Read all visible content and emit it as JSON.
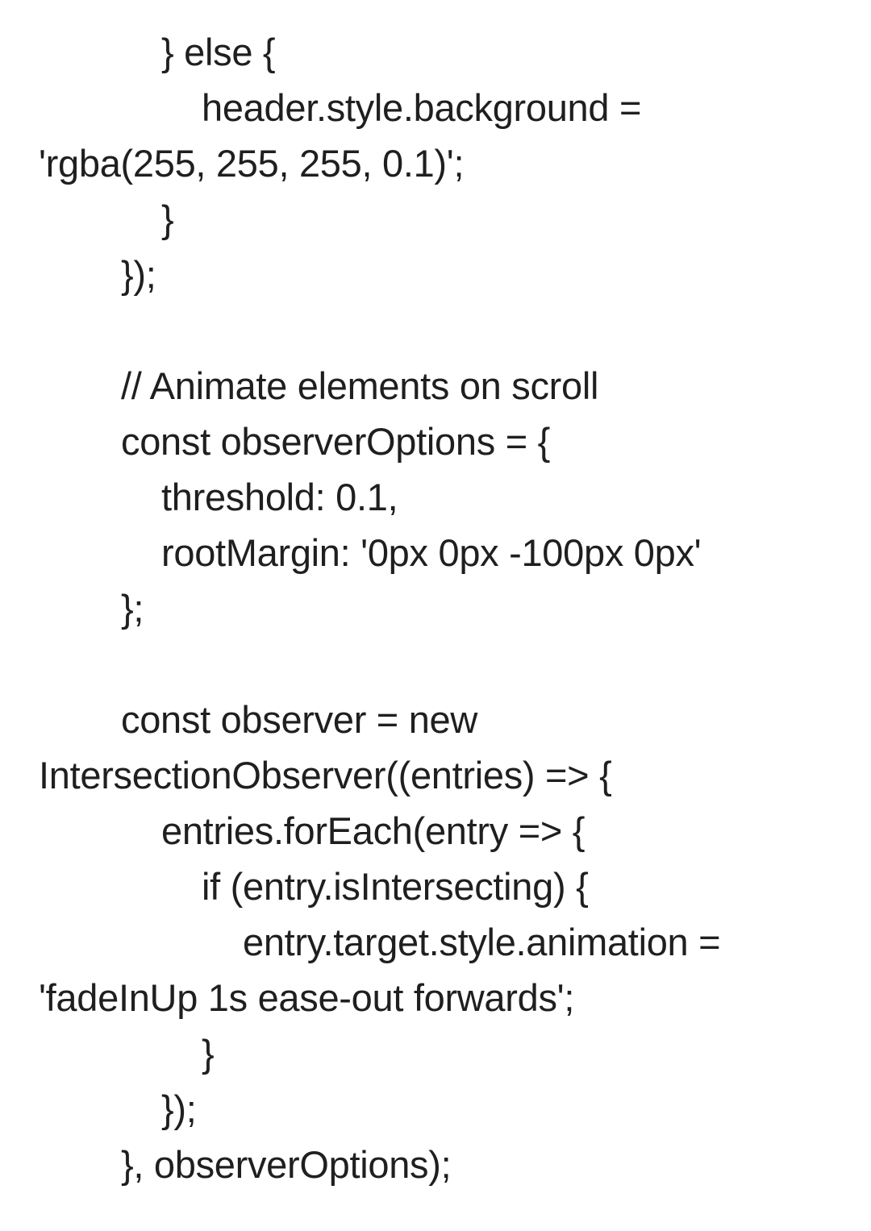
{
  "document": {
    "lines": [
      "} else {",
      "header.style.background =",
      "'rgba(255, 255, 255, 0.1)';",
      "}",
      "});",
      "",
      "// Animate elements on scroll",
      "const observerOptions = {",
      "threshold: 0.1,",
      "rootMargin: '0px 0px -100px 0px'",
      "};",
      "",
      "const observer = new",
      "IntersectionObserver((entries) => {",
      "entries.forEach(entry => {",
      "if (entry.isIntersecting) {",
      "entry.target.style.animation =",
      "'fadeInUp 1s ease-out forwards';",
      "}",
      "});",
      "}, observerOptions);"
    ]
  }
}
